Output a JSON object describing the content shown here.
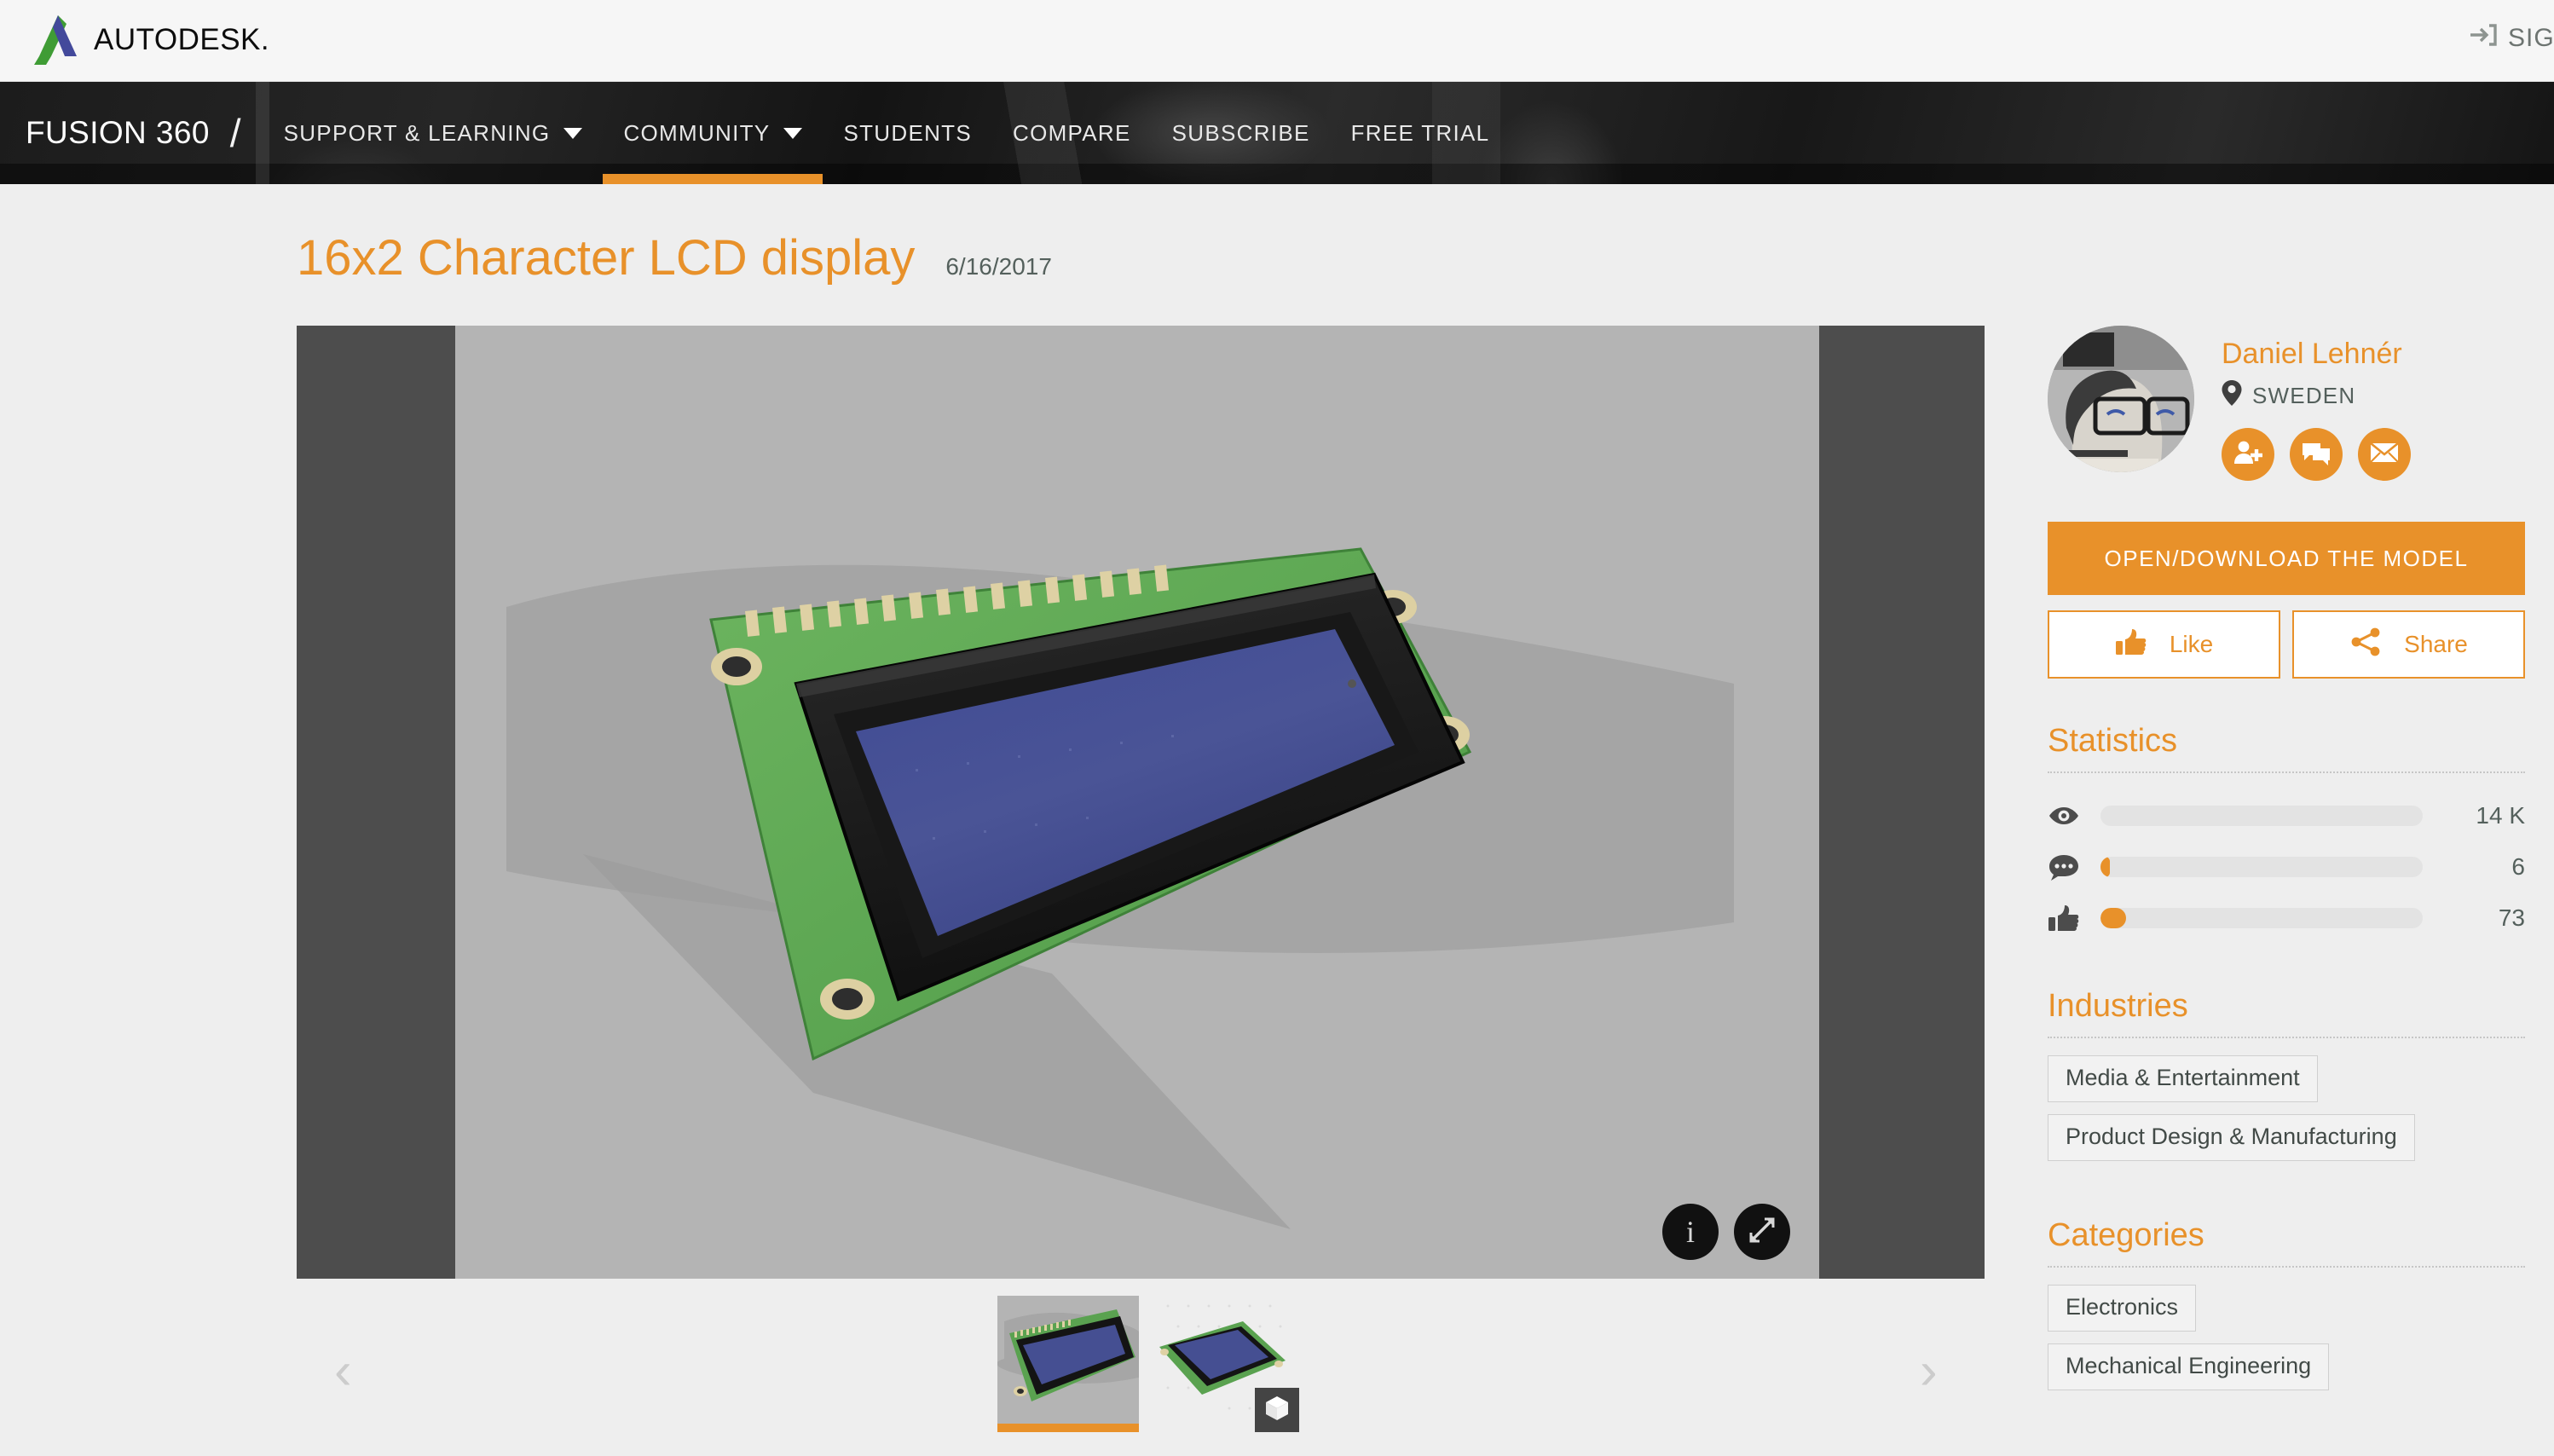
{
  "brand": {
    "logo_icon": "autodesk-logo-icon",
    "logo_word": "AUTODESK.",
    "signin_label": "SIGN IN",
    "signin_icon": "sign-in-icon"
  },
  "productnav": {
    "product": "FUSION 360",
    "separator": "/",
    "items": [
      {
        "label": "SUPPORT & LEARNING",
        "has_caret": true,
        "active": false
      },
      {
        "label": "COMMUNITY",
        "has_caret": true,
        "active": true
      },
      {
        "label": "STUDENTS",
        "has_caret": false,
        "active": false
      },
      {
        "label": "COMPARE",
        "has_caret": false,
        "active": false
      },
      {
        "label": "SUBSCRIBE",
        "has_caret": false,
        "active": false
      },
      {
        "label": "FREE TRIAL",
        "has_caret": false,
        "active": false
      }
    ],
    "accent_color": "#e8912a"
  },
  "header": {
    "title": "16x2 Character LCD display",
    "date": "6/16/2017"
  },
  "viewer": {
    "info_icon": "info-icon",
    "info_glyph": "i",
    "expand_icon": "expand-icon",
    "prev_icon": "chevron-left-icon",
    "next_icon": "chevron-right-icon",
    "prev_glyph": "‹",
    "next_glyph": "›",
    "backdrop_color": "#4d4d4d",
    "stage_color": "#b4b4b4",
    "thumbnails": [
      {
        "name": "thumbnail-1",
        "active": true,
        "badge": null
      },
      {
        "name": "thumbnail-2",
        "active": false,
        "badge": "cube-3d-icon"
      }
    ]
  },
  "author": {
    "avatar_icon": "avatar",
    "name": "Daniel Lehnér",
    "location": "SWEDEN",
    "location_icon": "map-pin-icon",
    "actions": [
      {
        "name": "follow-button",
        "icon": "add-user-icon"
      },
      {
        "name": "message-button",
        "icon": "chat-bubble-icon"
      },
      {
        "name": "email-button",
        "icon": "envelope-icon"
      }
    ]
  },
  "actions": {
    "primary_label": "OPEN/DOWNLOAD THE MODEL",
    "like_label": "Like",
    "like_icon": "thumbs-up-icon",
    "share_label": "Share",
    "share_icon": "share-icon"
  },
  "statistics": {
    "title": "Statistics",
    "rows": [
      {
        "name": "views",
        "icon": "eye-icon",
        "value": "14 K",
        "fill_pct": 0
      },
      {
        "name": "comments",
        "icon": "comment-icon",
        "value": "6",
        "fill_pct": 3
      },
      {
        "name": "likes",
        "icon": "thumbs-up-icon",
        "value": "73",
        "fill_pct": 8
      }
    ]
  },
  "industries": {
    "title": "Industries",
    "tags": [
      "Media & Entertainment",
      "Product Design & Manufacturing"
    ]
  },
  "categories": {
    "title": "Categories",
    "tags": [
      "Electronics",
      "Mechanical Engineering"
    ]
  },
  "colors": {
    "accent": "#e8912a",
    "text_dark": "#54605c",
    "page_bg": "#eeeeee",
    "nav_bg": "#161616"
  }
}
